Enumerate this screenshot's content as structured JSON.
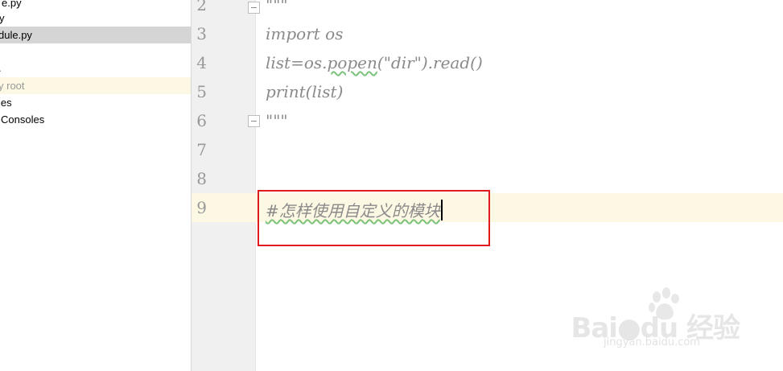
{
  "project_tree": {
    "items": [
      {
        "label": "e.py",
        "state": "normal"
      },
      {
        "label": "y",
        "state": "normal"
      },
      {
        "label": "dule.py",
        "state": "selected"
      },
      {
        "label": ".",
        "state": "normal"
      },
      {
        "label": "y root",
        "state": "highlight"
      },
      {
        "label": "ies",
        "state": "normal"
      },
      {
        "label": "Consoles",
        "state": "normal"
      }
    ]
  },
  "editor": {
    "lines": [
      {
        "number": "2",
        "text": "\"\"\""
      },
      {
        "number": "3",
        "text": "import os"
      },
      {
        "number": "4",
        "text_parts": [
          "list=os.",
          "popen",
          "(\"dir\").read()"
        ]
      },
      {
        "number": "5",
        "text": "print(list)"
      },
      {
        "number": "6",
        "text": "\"\"\""
      },
      {
        "number": "7",
        "text": ""
      },
      {
        "number": "8",
        "text": ""
      },
      {
        "number": "9",
        "text": "#怎样使用自定义的模块"
      }
    ],
    "current_line": "9"
  },
  "colors": {
    "annotation_box": "#e01b1b",
    "caret_line": "#fdf8e3",
    "comment_text": "#8a8a8a"
  },
  "watermark": {
    "brand": "Bai●du 经验",
    "url": "jingyan.baidu.com"
  }
}
